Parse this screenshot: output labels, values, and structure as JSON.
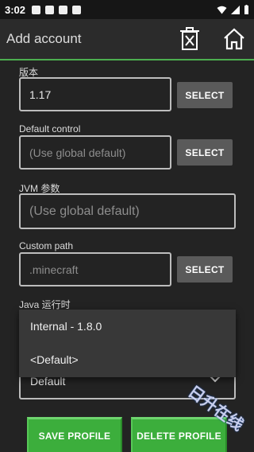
{
  "status_bar": {
    "time": "3:02"
  },
  "app_bar": {
    "title": "Add account"
  },
  "fields": {
    "version": {
      "label": "版本",
      "value": "1.17",
      "button": "SELECT"
    },
    "default_control": {
      "label": "Default control",
      "placeholder": "(Use global default)",
      "button": "SELECT"
    },
    "jvm_args": {
      "label": "JVM 参数",
      "placeholder": "(Use global default)"
    },
    "custom_path": {
      "label": "Custom path",
      "placeholder": ".minecraft",
      "button": "SELECT"
    },
    "java_runtime": {
      "label": "Java 运行时",
      "selected": "Default",
      "options": [
        "Internal - 1.8.0",
        "<Default>"
      ]
    }
  },
  "actions": {
    "save": "SAVE PROFILE",
    "delete": "DELETE PROFILE"
  },
  "watermark": "日升在线",
  "colors": {
    "accent": "#4caf50",
    "button_green": "#3cae3c",
    "background": "#232323",
    "select_button": "#5a5a5a"
  },
  "icons": [
    "delete-icon",
    "home-icon",
    "chevron-down-icon"
  ]
}
